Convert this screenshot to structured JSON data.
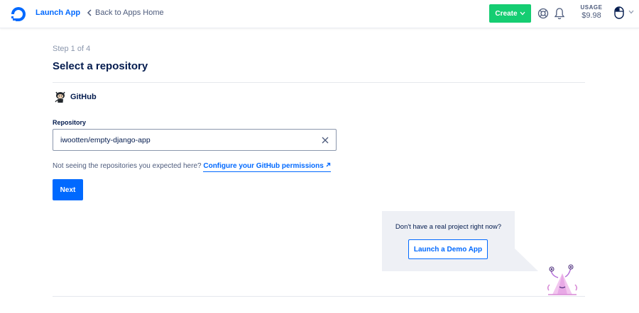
{
  "topbar": {
    "launch_app": "Launch App",
    "back_label": "Back to Apps Home",
    "create_label": "Create",
    "usage_label": "USAGE",
    "usage_value": "$9.98",
    "icons": [
      "digitalocean-logo-icon",
      "chevron-left-icon",
      "chevron-down-icon",
      "help-icon",
      "bell-icon",
      "avatar-icon",
      "chevron-down-icon"
    ]
  },
  "main": {
    "step": "Step 1 of 4",
    "title": "Select a repository",
    "provider": "GitHub",
    "repository_label": "Repository",
    "repository_value": "iwootten/empty-django-app",
    "hint_text": "Not seeing the repositories you expected here?",
    "hint_link": "Configure your GitHub permissions",
    "next_label": "Next"
  },
  "demo": {
    "text": "Don't have a real project right now?",
    "button_label": "Launch a Demo App"
  },
  "colors": {
    "primary": "#0069ff",
    "create_green": "#15cd72",
    "text_dark": "#031b4e",
    "text_muted": "#8b97ad"
  }
}
